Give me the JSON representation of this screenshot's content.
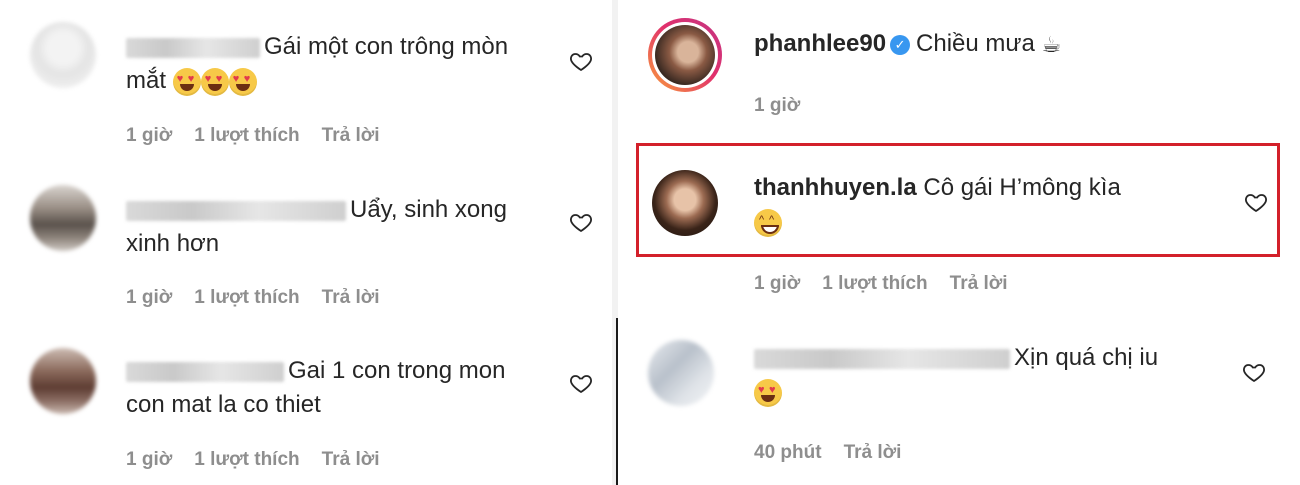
{
  "left_comments": [
    {
      "text_line1": "Gái một con trông mòn",
      "text_line2": "mắt",
      "time": "1 giờ",
      "likes": "1 lượt thích",
      "reply": "Trả lời"
    },
    {
      "text_line1": "Uẩy, sinh xong",
      "text_line2": "xinh hơn",
      "time": "1 giờ",
      "likes": "1 lượt thích",
      "reply": "Trả lời"
    },
    {
      "text_line1": "Gai 1 con trong mon",
      "text_line2": "con mat la co thiet",
      "time": "1 giờ",
      "likes": "1 lượt thích",
      "reply": "Trả lời"
    }
  ],
  "right_comments": [
    {
      "username": "phanhlee90",
      "verified": true,
      "text": "Chiều mưa",
      "time": "1 giờ"
    },
    {
      "username": "thanhhuyen.la",
      "text": "Cô gái H’mông kìa",
      "time": "1 giờ",
      "likes": "1 lượt thích",
      "reply": "Trả lời",
      "highlight_color": "#d3202a"
    },
    {
      "text": "Xịn quá chị iu",
      "time": "40 phút",
      "reply": "Trả lời"
    }
  ],
  "icons": [
    "heart-outline-icon",
    "verified-badge-icon",
    "coffee-icon",
    "heart-eyes-emoji",
    "grin-emoji"
  ],
  "colors": {
    "meta_text": "#8e8e8e",
    "verified_blue": "#3897f0",
    "highlight_red": "#d3202a"
  }
}
